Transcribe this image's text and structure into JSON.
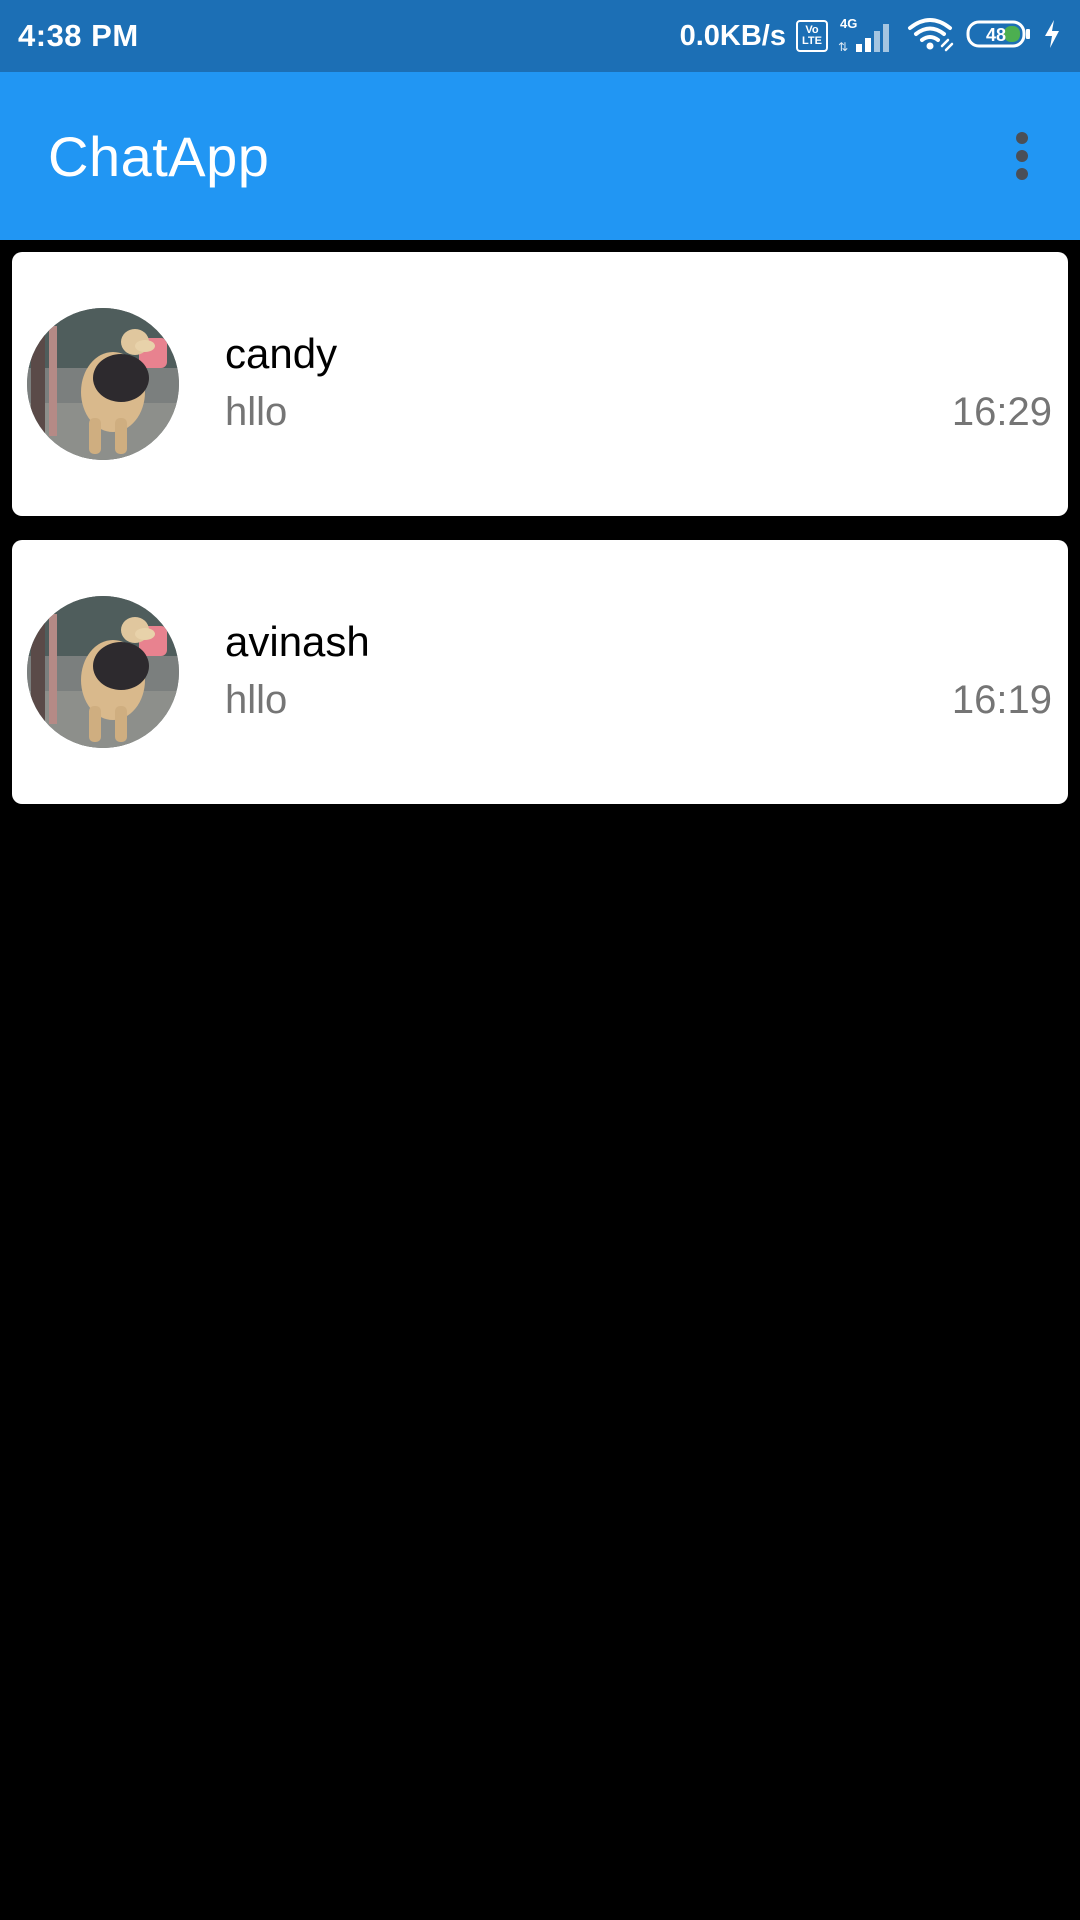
{
  "status_bar": {
    "time": "4:38 PM",
    "net_speed": "0.0KB/s",
    "volte_top": "Vo",
    "volte_bottom": "LTE",
    "network_type": "4G",
    "battery_level": "48",
    "icons": [
      "volte-icon",
      "signal-icon",
      "wifi-icon",
      "battery-icon",
      "charging-icon"
    ]
  },
  "app_bar": {
    "title": "ChatApp",
    "menu_icon": "overflow-menu-icon"
  },
  "chats": [
    {
      "name": "candy",
      "last_message": "hllo",
      "time": "16:29",
      "avatar_icon": "dog-photo-avatar"
    },
    {
      "name": "avinash",
      "last_message": "hllo",
      "time": "16:19",
      "avatar_icon": "dog-photo-avatar"
    }
  ],
  "colors": {
    "status_bar": "#1c6fb5",
    "app_bar": "#2196f3",
    "background": "#000000",
    "card": "#ffffff",
    "secondary_text": "#757575"
  }
}
